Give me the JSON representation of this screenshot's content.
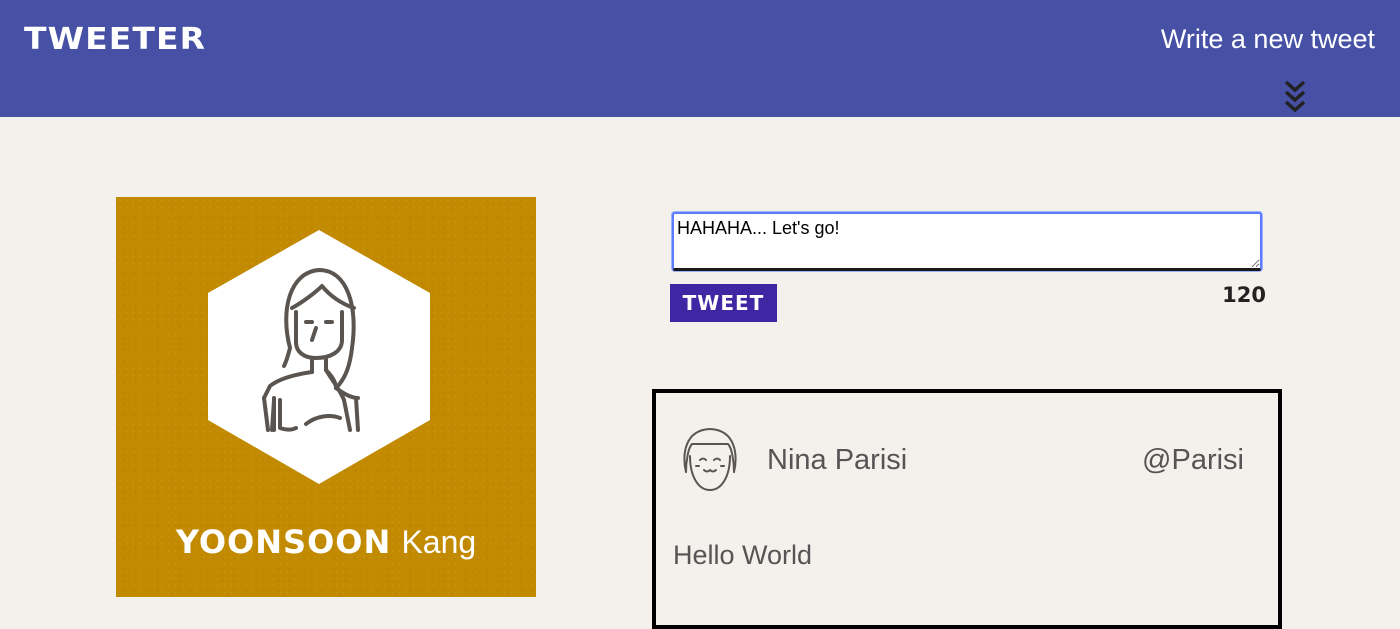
{
  "navbar": {
    "brand": "TWEETER",
    "write_link": "Write a new tweet",
    "toggle_icon": "double-chevron-down-icon",
    "background": "#4650a5"
  },
  "profile": {
    "first_name": "YOONSOON",
    "last_name": "Kang",
    "avatar_icon": "woman-avatar-icon",
    "background": "#c18a00"
  },
  "compose": {
    "text": "HAHAHA... Let's go!",
    "button_label": "TWEET",
    "char_counter": "120",
    "button_color": "#3f27a3"
  },
  "tweets": [
    {
      "name": "Nina Parisi",
      "handle": "@Parisi",
      "text": "Hello World",
      "avatar_icon": "smiling-girl-avatar-icon"
    }
  ]
}
